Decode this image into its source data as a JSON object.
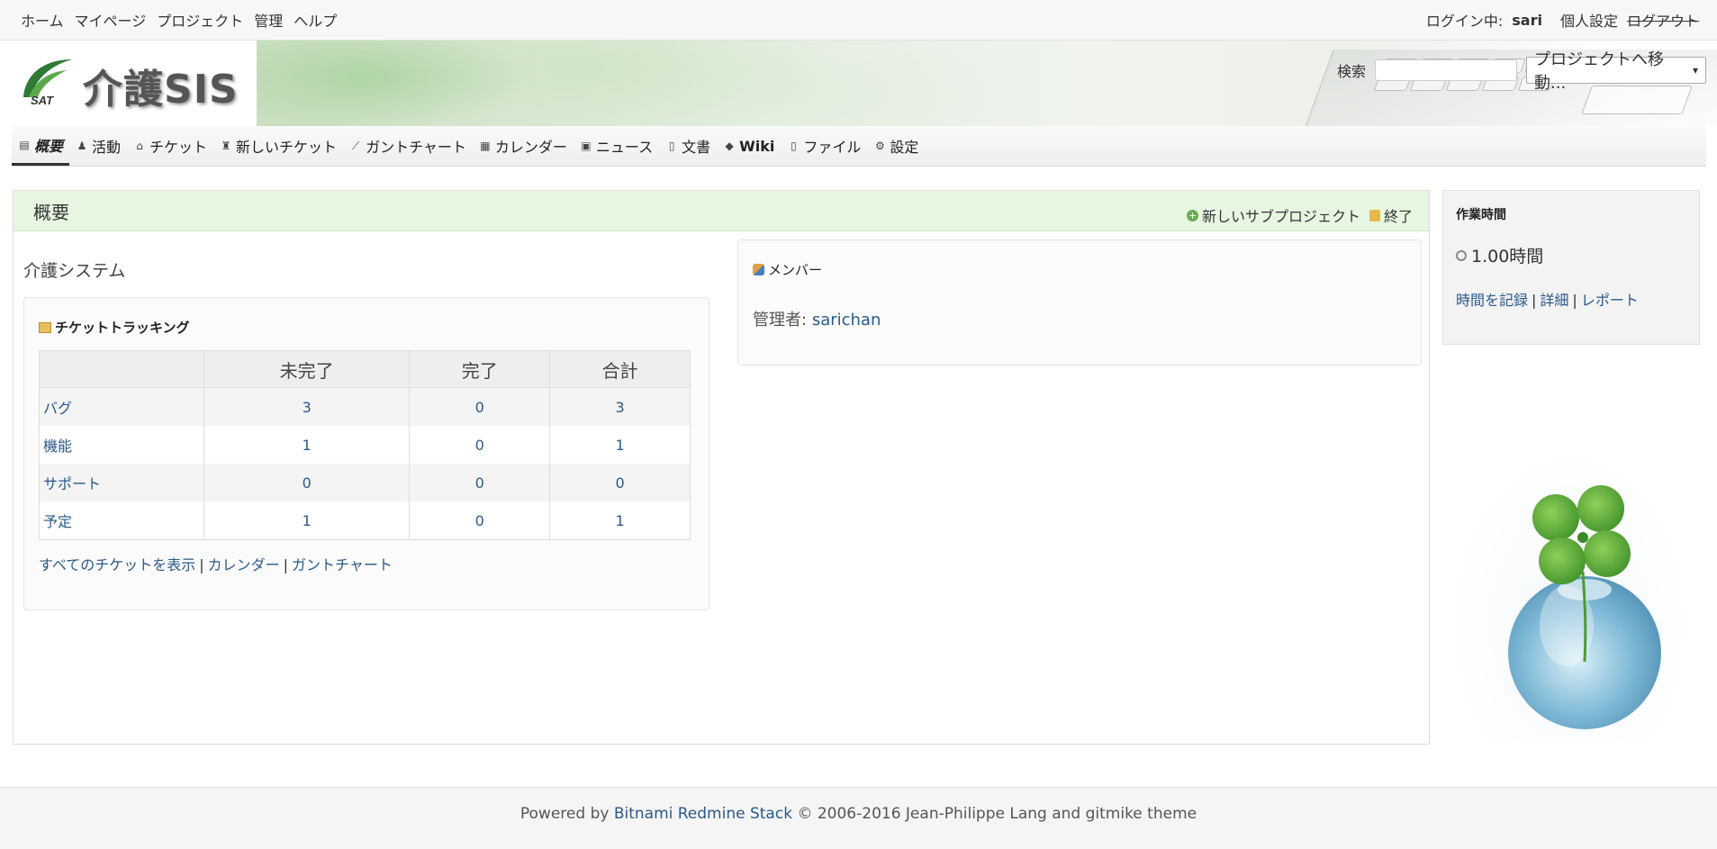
{
  "top_menu": {
    "left_items": [
      "ホーム",
      "マイページ",
      "プロジェクト",
      "管理",
      "ヘルプ"
    ],
    "logged_in_label": "ログイン中:",
    "user": "sari",
    "my_account": "個人設定",
    "logout": "ログアウト"
  },
  "header": {
    "site_title": "介護SIS",
    "logo_text": "SAT",
    "search_label": "検索",
    "search_value": "",
    "jump_label": "プロジェクトへ移動...",
    "jump_arrow": "▾"
  },
  "main_menu": [
    {
      "label": "概要",
      "icon": "overview-icon",
      "glyph": "▤",
      "selected": true
    },
    {
      "label": "活動",
      "icon": "activity-icon",
      "glyph": "♟",
      "selected": false
    },
    {
      "label": "チケット",
      "icon": "issues-icon",
      "glyph": "⌂",
      "selected": false
    },
    {
      "label": "新しいチケット",
      "icon": "new-issue-icon",
      "glyph": "♜",
      "selected": false
    },
    {
      "label": "ガントチャート",
      "icon": "gantt-icon",
      "glyph": "⟋",
      "selected": false
    },
    {
      "label": "カレンダー",
      "icon": "calendar-icon",
      "glyph": "▦",
      "selected": false
    },
    {
      "label": "ニュース",
      "icon": "news-icon",
      "glyph": "▣",
      "selected": false
    },
    {
      "label": "文書",
      "icon": "documents-icon",
      "glyph": "▯",
      "selected": false
    },
    {
      "label": "Wiki",
      "icon": "wiki-icon",
      "glyph": "◆",
      "selected": false
    },
    {
      "label": "ファイル",
      "icon": "files-icon",
      "glyph": "▯",
      "selected": false
    },
    {
      "label": "設定",
      "icon": "settings-icon",
      "glyph": "⚙",
      "selected": false
    }
  ],
  "content": {
    "title": "概要",
    "new_subproject": "新しいサブプロジェクト",
    "close": "終了",
    "description": "介護システム",
    "issues": {
      "heading": "チケットトラッキング",
      "columns": [
        "",
        "未完了",
        "完了",
        "合計"
      ],
      "rows": [
        {
          "name": "バグ",
          "open": "3",
          "closed": "0",
          "total": "3"
        },
        {
          "name": "機能",
          "open": "1",
          "closed": "0",
          "total": "1"
        },
        {
          "name": "サポート",
          "open": "0",
          "closed": "0",
          "total": "0"
        },
        {
          "name": "予定",
          "open": "1",
          "closed": "0",
          "total": "1"
        }
      ],
      "links": [
        "すべてのチケットを表示",
        "カレンダー",
        "ガントチャート"
      ],
      "separator": "|"
    },
    "members": {
      "heading": "メンバー",
      "role": "管理者:",
      "member": "sarichan"
    }
  },
  "sidebar": {
    "heading": "作業時間",
    "hours": "1.00時間",
    "links": [
      "時間を記録",
      "詳細",
      "レポート"
    ],
    "separator": "|"
  },
  "footer": {
    "powered_by": "Powered by",
    "product": "Bitnami Redmine Stack",
    "copyright": "© 2006-2016 Jean-Philippe Lang and gitmike theme"
  },
  "colors": {
    "link": "#2a5a8a",
    "title_bar": "#e6f6e0",
    "accent_green": "#6aaa52"
  }
}
